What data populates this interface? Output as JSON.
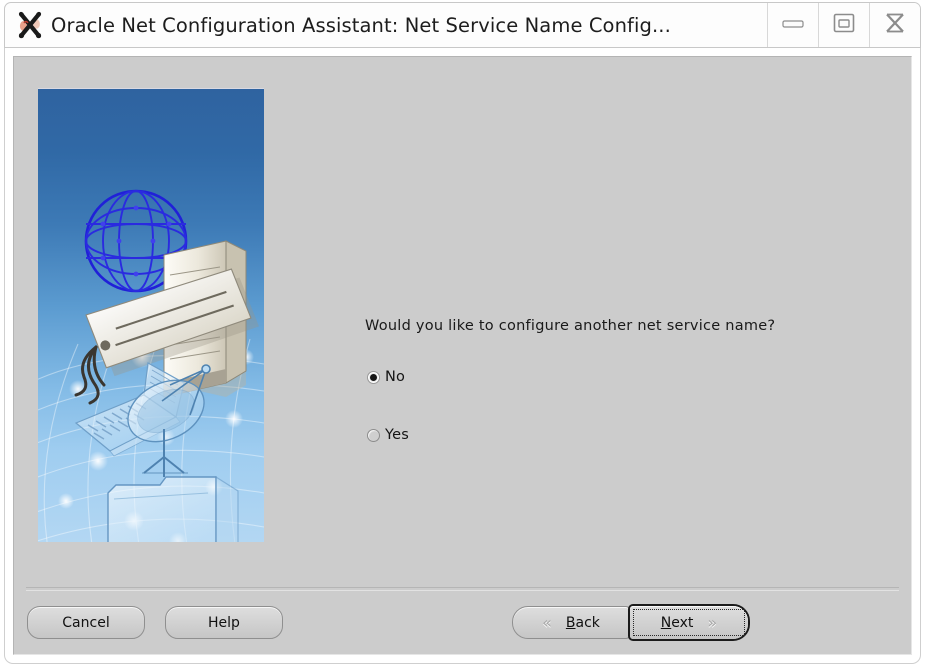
{
  "window": {
    "title": "Oracle Net Configuration Assistant: Net Service Name Config...",
    "app_icon": "x11-logo-icon",
    "controls": [
      {
        "name": "minimize",
        "glyph": "minimize-icon"
      },
      {
        "name": "maximize",
        "glyph": "maximize-icon"
      },
      {
        "name": "close",
        "glyph": "close-icon"
      }
    ]
  },
  "illustration": {
    "alt": "network-illustration",
    "gradient_top": "#2f63a0",
    "gradient_bottom": "#b3d7f3",
    "elements": [
      "globe-network",
      "server-tower",
      "name-tag",
      "laptop",
      "satellite-dish",
      "folder",
      "network-grid"
    ]
  },
  "main": {
    "question": "Would you like to configure another net service name?",
    "options": [
      {
        "label": "No",
        "selected": true
      },
      {
        "label": "Yes",
        "selected": false
      }
    ]
  },
  "buttons": {
    "cancel": "Cancel",
    "help": "Help",
    "back": {
      "label": "Back",
      "mnemonic": "B",
      "rest": "ack",
      "chevron": "«"
    },
    "next": {
      "label": "Next",
      "mnemonic": "N",
      "rest": "ext",
      "chevron": "»",
      "focused": true
    }
  },
  "colors": {
    "dialog_bg": "#cccccc",
    "titlebar_bg": "#fdfdfd",
    "text": "#1a1a1a",
    "button_face": "#d3d3d3"
  }
}
